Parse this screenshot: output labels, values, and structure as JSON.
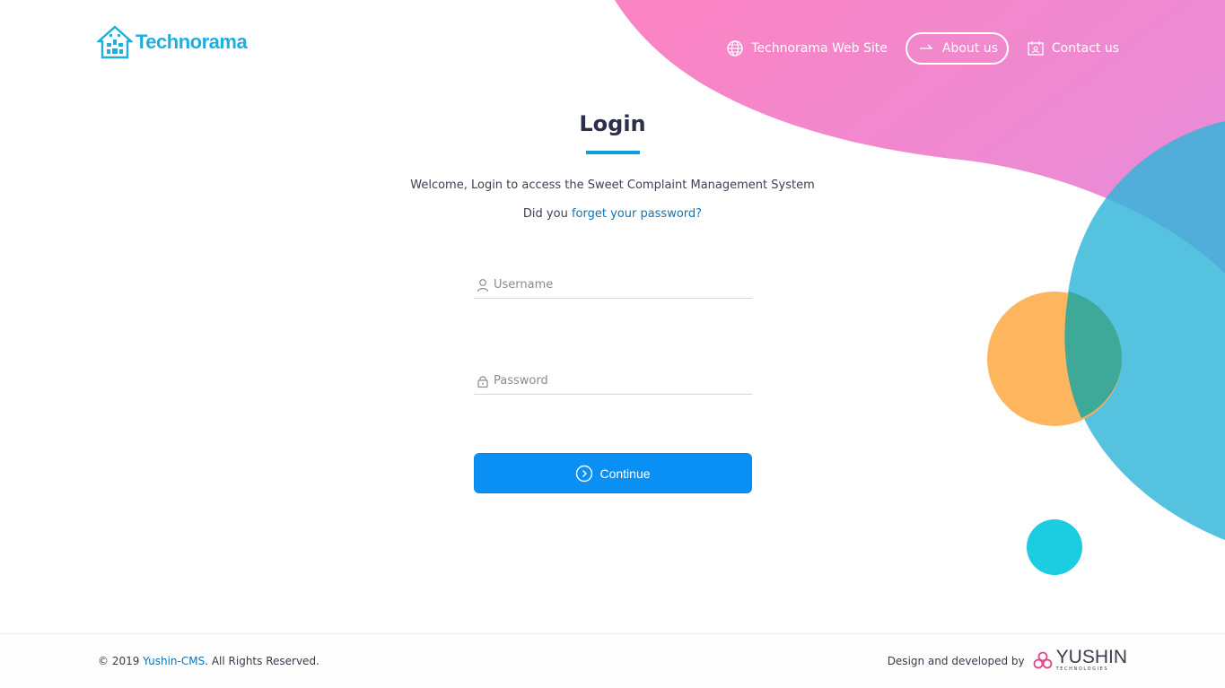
{
  "brand": {
    "name": "Technorama",
    "color": "#1eaedf"
  },
  "nav": {
    "items": [
      {
        "label": "Technorama Web Site",
        "icon": "globe-icon"
      },
      {
        "label": "About us",
        "icon": "arrow-right-icon"
      },
      {
        "label": "Contact us",
        "icon": "contact-card-icon"
      }
    ]
  },
  "login": {
    "title": "Login",
    "welcome": "Welcome, Login to access the Sweet Complaint Management System",
    "forgot_prefix": "Did you ",
    "forgot_link": "forget your password?",
    "username_placeholder": "Username",
    "password_placeholder": "Password",
    "continue_label": "Continue"
  },
  "footer": {
    "copyright_prefix": "© 2019 ",
    "copyright_link": "Yushin-CMS",
    "copyright_suffix": ". All Rights Reserved.",
    "credit": "Design and developed by",
    "company_name": "YUSHIN",
    "company_sub": "TECHNOLOGIES"
  },
  "colors": {
    "accent": "#0a8ff5",
    "link": "#1173b7",
    "blob_pink": "#f07ec4",
    "blob_blue": "#2fb4d9",
    "circle_orange": "#fdb04f",
    "circle_cyan": "#1ccde2"
  }
}
